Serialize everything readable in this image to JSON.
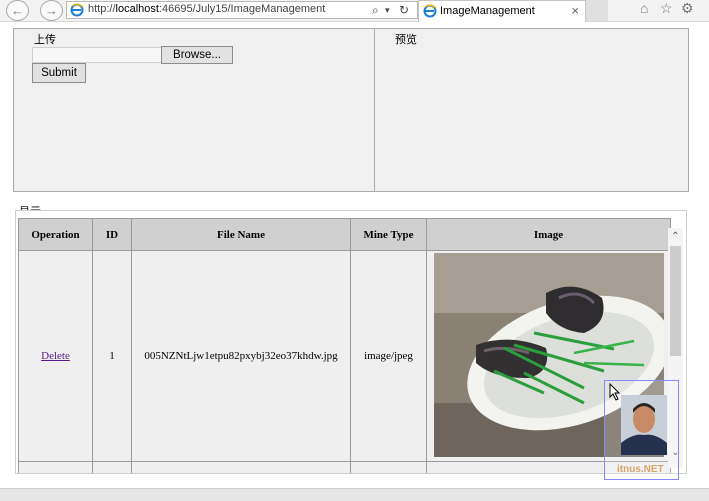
{
  "browser": {
    "url_prefix": "http://",
    "url_host": "localhost",
    "url_rest": ":46695/July15/ImageManagement",
    "tab_title": "ImageManagement",
    "tab_close": "×",
    "search_icon": "⌕",
    "dropdown_icon": "▾",
    "refresh_icon": "↻",
    "home_icon": "⌂",
    "star_icon": "☆",
    "gear_icon": "⚙",
    "back_icon": "←",
    "forward_icon": "→"
  },
  "upload": {
    "title": "上传",
    "browse_label": "Browse...",
    "submit_label": "Submit"
  },
  "preview": {
    "title": "预览"
  },
  "display": {
    "title": "显示",
    "columns": [
      "Operation",
      "ID",
      "File Name",
      "Mine Type",
      "Image"
    ],
    "rows": [
      {
        "operation": "Delete",
        "id": "1",
        "file_name": "005NZNtLjw1etpu82pxybj32eo37khdw.jpg",
        "mime_type": "image/jpeg"
      }
    ]
  },
  "scroll": {
    "up_icon": "⌃",
    "down_icon": "⌄"
  },
  "overlay": {
    "watermark": "itnus.NET"
  },
  "colors": {
    "header_bg": "#d0d0d0",
    "cell_bg": "#efefef",
    "link": "#551a8b",
    "panel_bg": "#f0f0f0"
  }
}
